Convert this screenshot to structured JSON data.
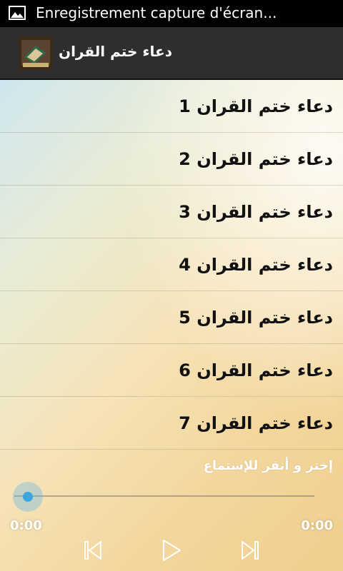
{
  "status_bar": {
    "notification": "Enregistrement capture d'écran..."
  },
  "action_bar": {
    "title": "دعاء ختم القران"
  },
  "tracks": [
    {
      "label": "1 دعاء ختم القران"
    },
    {
      "label": "2 دعاء ختم القران"
    },
    {
      "label": "3 دعاء ختم القران"
    },
    {
      "label": "4 دعاء ختم القران"
    },
    {
      "label": "5 دعاء ختم القران"
    },
    {
      "label": "6 دعاء ختم القران"
    },
    {
      "label": "7 دعاء ختم القران"
    }
  ],
  "player": {
    "hint": "إختر و أنقر للإستماع",
    "elapsed": "0:00",
    "duration": "0:00",
    "progress": 0
  },
  "colors": {
    "accent": "#3ea6de",
    "action_bar": "#2e2e2e"
  },
  "icons": [
    "image-icon",
    "app-icon",
    "previous-icon",
    "play-icon",
    "next-icon"
  ]
}
